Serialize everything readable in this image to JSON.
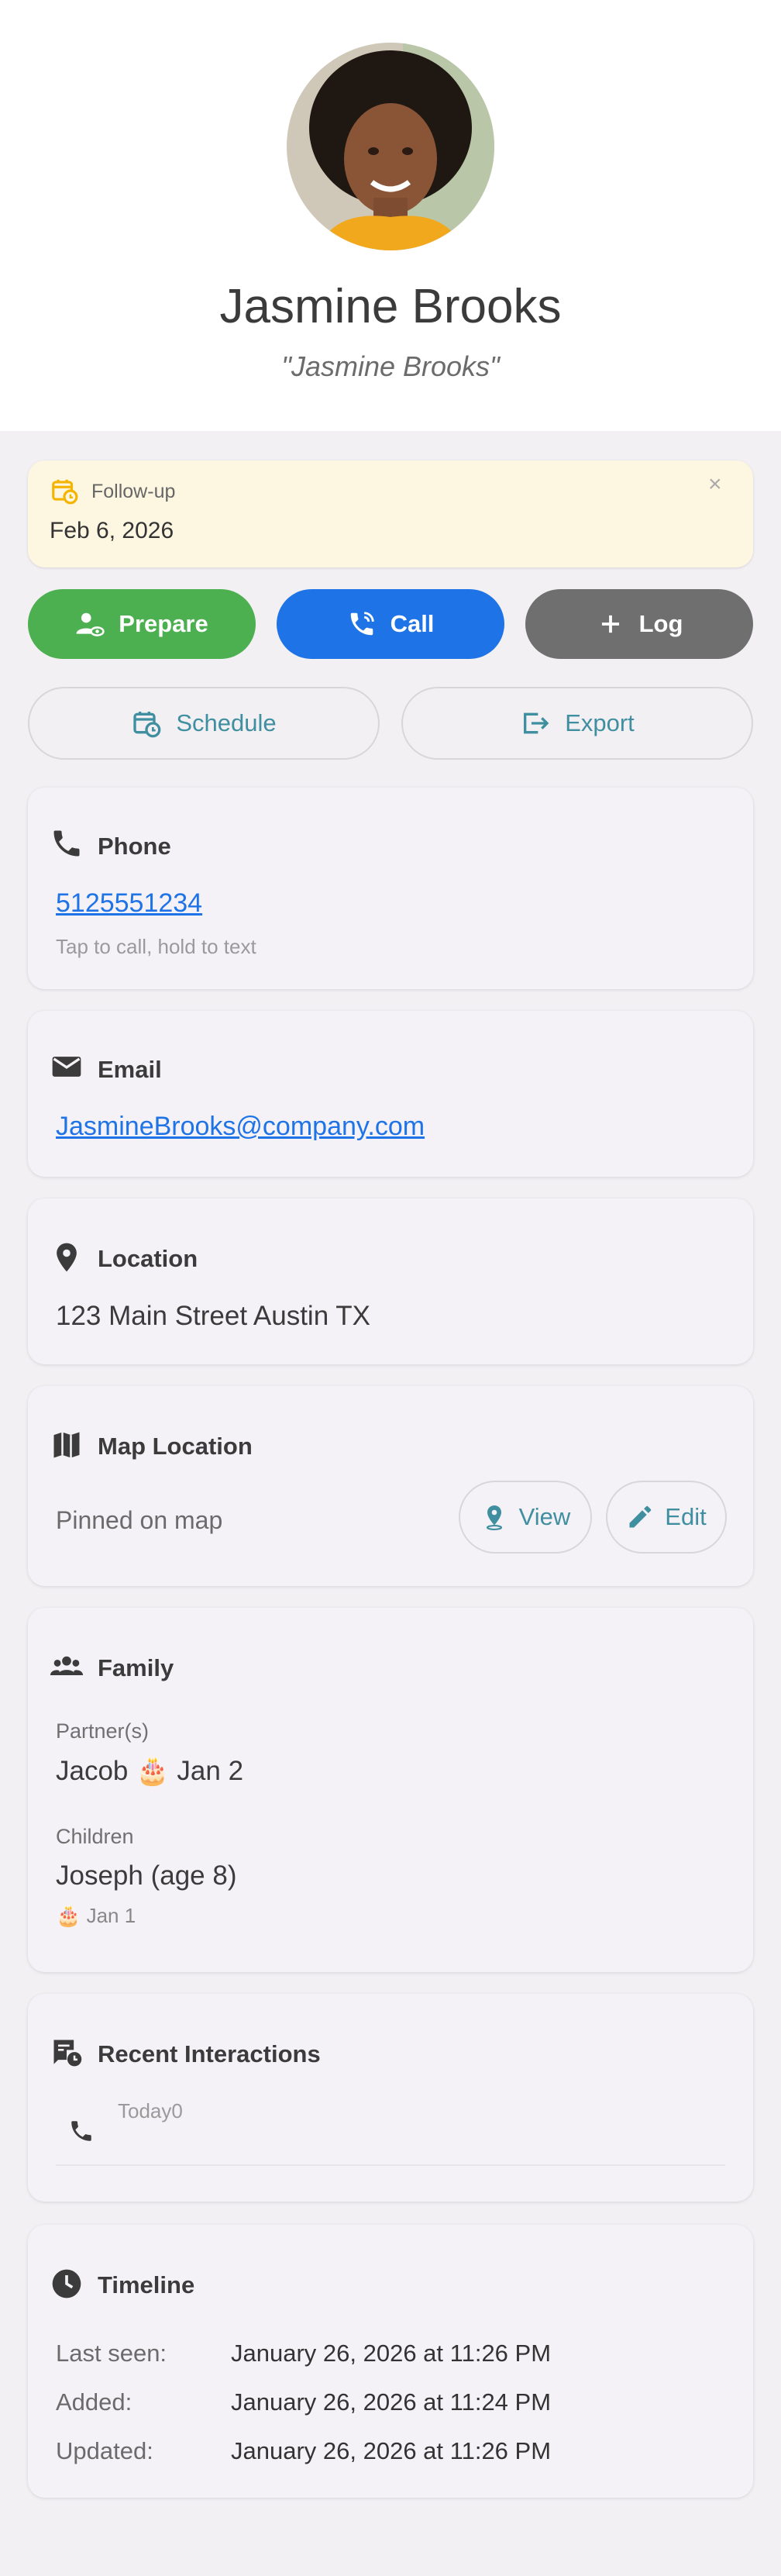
{
  "profile": {
    "name": "Jasmine Brooks",
    "nickname": "\"Jasmine Brooks\""
  },
  "followup": {
    "label": "Follow-up",
    "date": "Feb 6, 2026",
    "close": "×",
    "icon": "calendar-clock-icon"
  },
  "actions": {
    "prepare": "Prepare",
    "call": "Call",
    "log": "Log",
    "schedule": "Schedule",
    "export": "Export"
  },
  "phone": {
    "title": "Phone",
    "number": "5125551234",
    "hint": "Tap to call, hold to text"
  },
  "email": {
    "title": "Email",
    "address": "JasmineBrooks@company.com"
  },
  "location": {
    "title": "Location",
    "address": "123 Main Street Austin TX"
  },
  "map": {
    "title": "Map Location",
    "status": "Pinned on map",
    "view": "View",
    "edit": "Edit"
  },
  "family": {
    "title": "Family",
    "partners_label": "Partner(s)",
    "partner": "Jacob 🎂 Jan 2",
    "children_label": "Children",
    "child": "Joseph (age 8)",
    "child_birthday": "🎂 Jan 1"
  },
  "interactions": {
    "title": "Recent Interactions",
    "item_date": "Today0"
  },
  "timeline": {
    "title": "Timeline",
    "rows": [
      {
        "label": "Last seen:",
        "value": "January 26, 2026 at 11:26 PM"
      },
      {
        "label": "Added:",
        "value": "January 26, 2026 at 11:24 PM"
      },
      {
        "label": "Updated:",
        "value": "January 26, 2026 at 11:26 PM"
      }
    ]
  },
  "colors": {
    "prepare": "#4caf50",
    "call": "#1e74e6",
    "log": "#6f6f6f",
    "accent": "#3f8fa0",
    "followup_bg": "#fdf6e1"
  }
}
